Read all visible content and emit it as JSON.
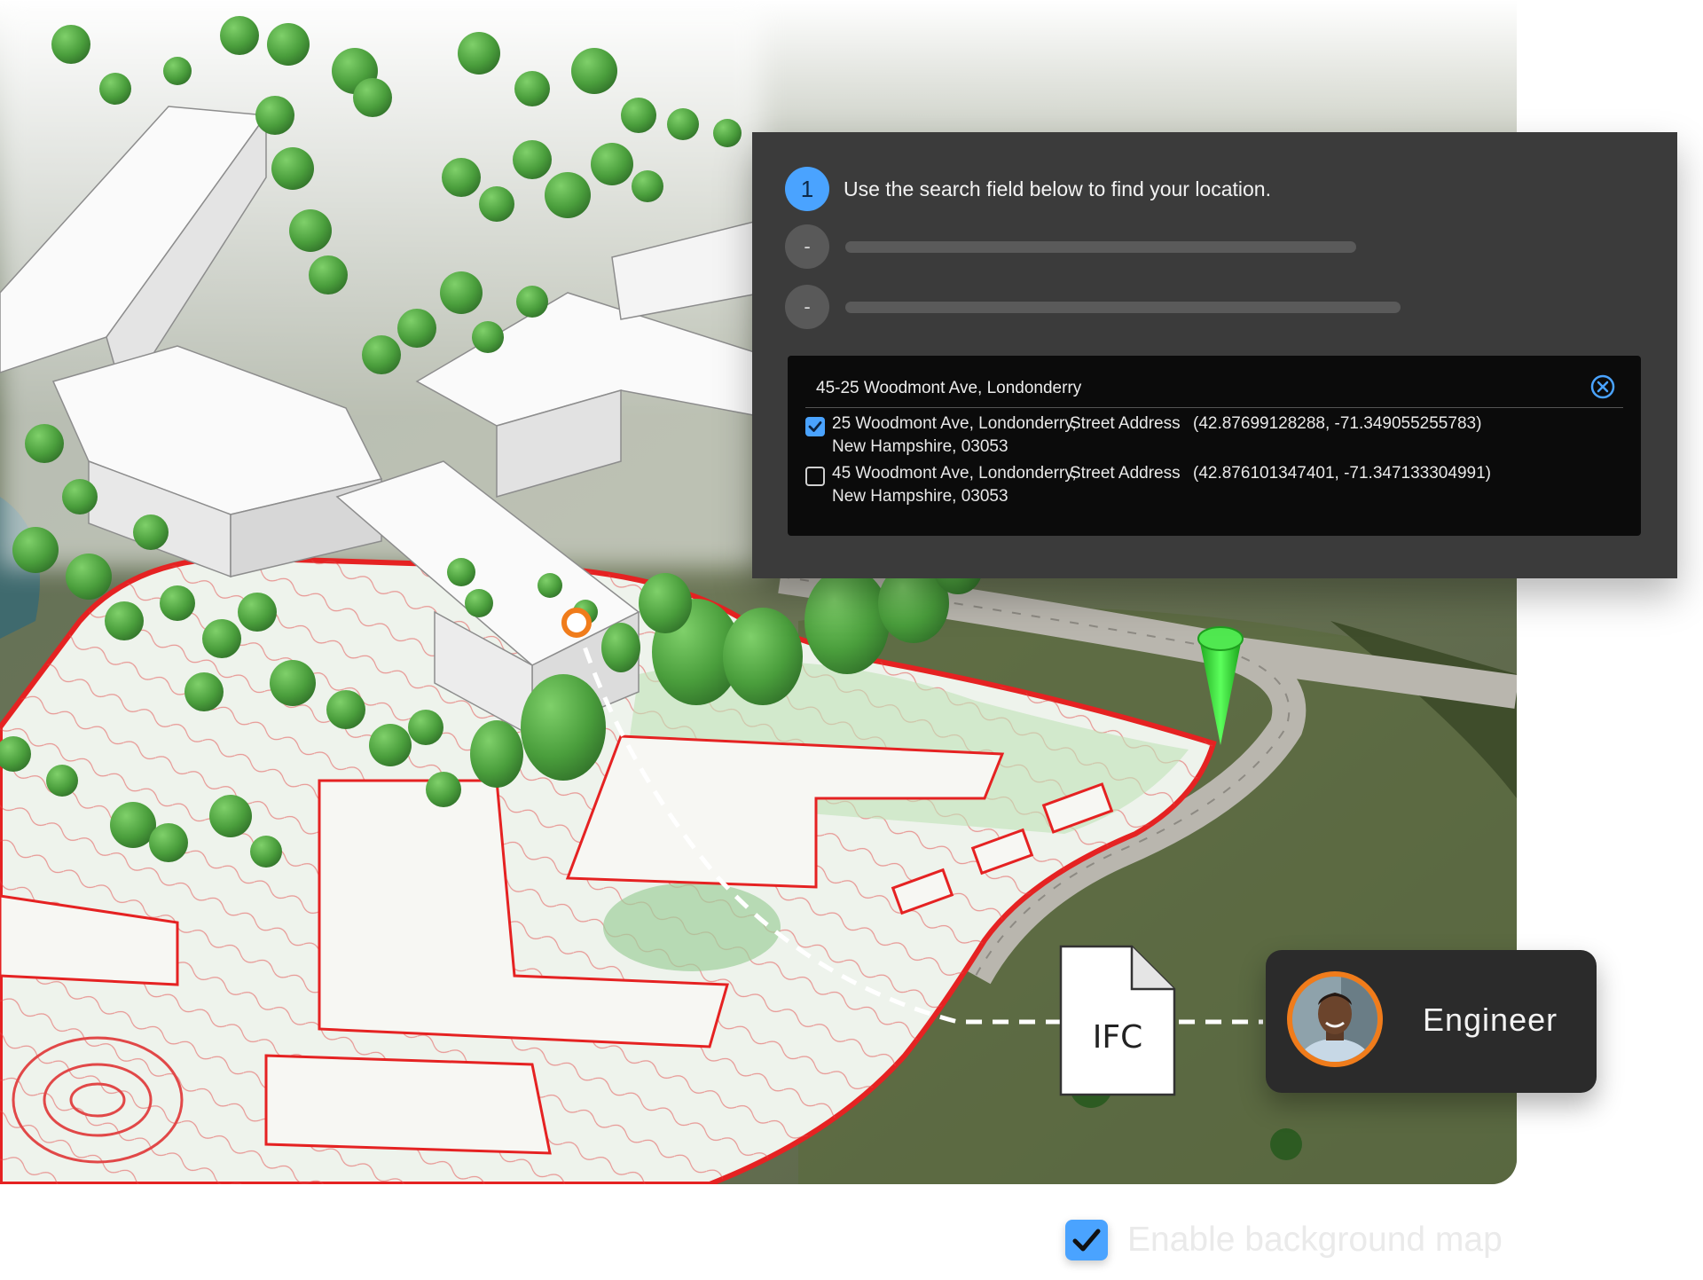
{
  "steps": {
    "step1_number": "1",
    "step1_text": "Use the search field below to find your location.",
    "step2_marker": "-",
    "step3_marker": "-"
  },
  "search": {
    "value": "45-25 Woodmont Ave, Londonderry"
  },
  "results": [
    {
      "checked": true,
      "address_line1": "25 Woodmont Ave, Londonderry,",
      "address_line2": "New Hampshire, 03053",
      "type": "Street Address",
      "coordinates": "(42.87699128288, -71.349055255783)"
    },
    {
      "checked": false,
      "address_line1": "45 Woodmont Ave, Londonderry,",
      "address_line2": "New Hampshire, 03053",
      "type": "Street Address",
      "coordinates": "(42.876101347401, -71.347133304991)"
    }
  ],
  "file": {
    "label": "IFC"
  },
  "role": {
    "label": "Engineer"
  },
  "background_map": {
    "label": "Enable background map",
    "checked": true
  },
  "icons": {
    "clear": "close-circle-icon",
    "check": "checkmark-icon",
    "pin": "location-pin-icon",
    "file": "document-icon",
    "marker": "location-ring-icon"
  },
  "colors": {
    "accent": "#4aa3ff",
    "panel": "#3b3b3b",
    "site_boundary": "#e52222",
    "marker": "#f07c1b",
    "pin": "#2ecc2e",
    "trees": "#4a9e3c"
  }
}
